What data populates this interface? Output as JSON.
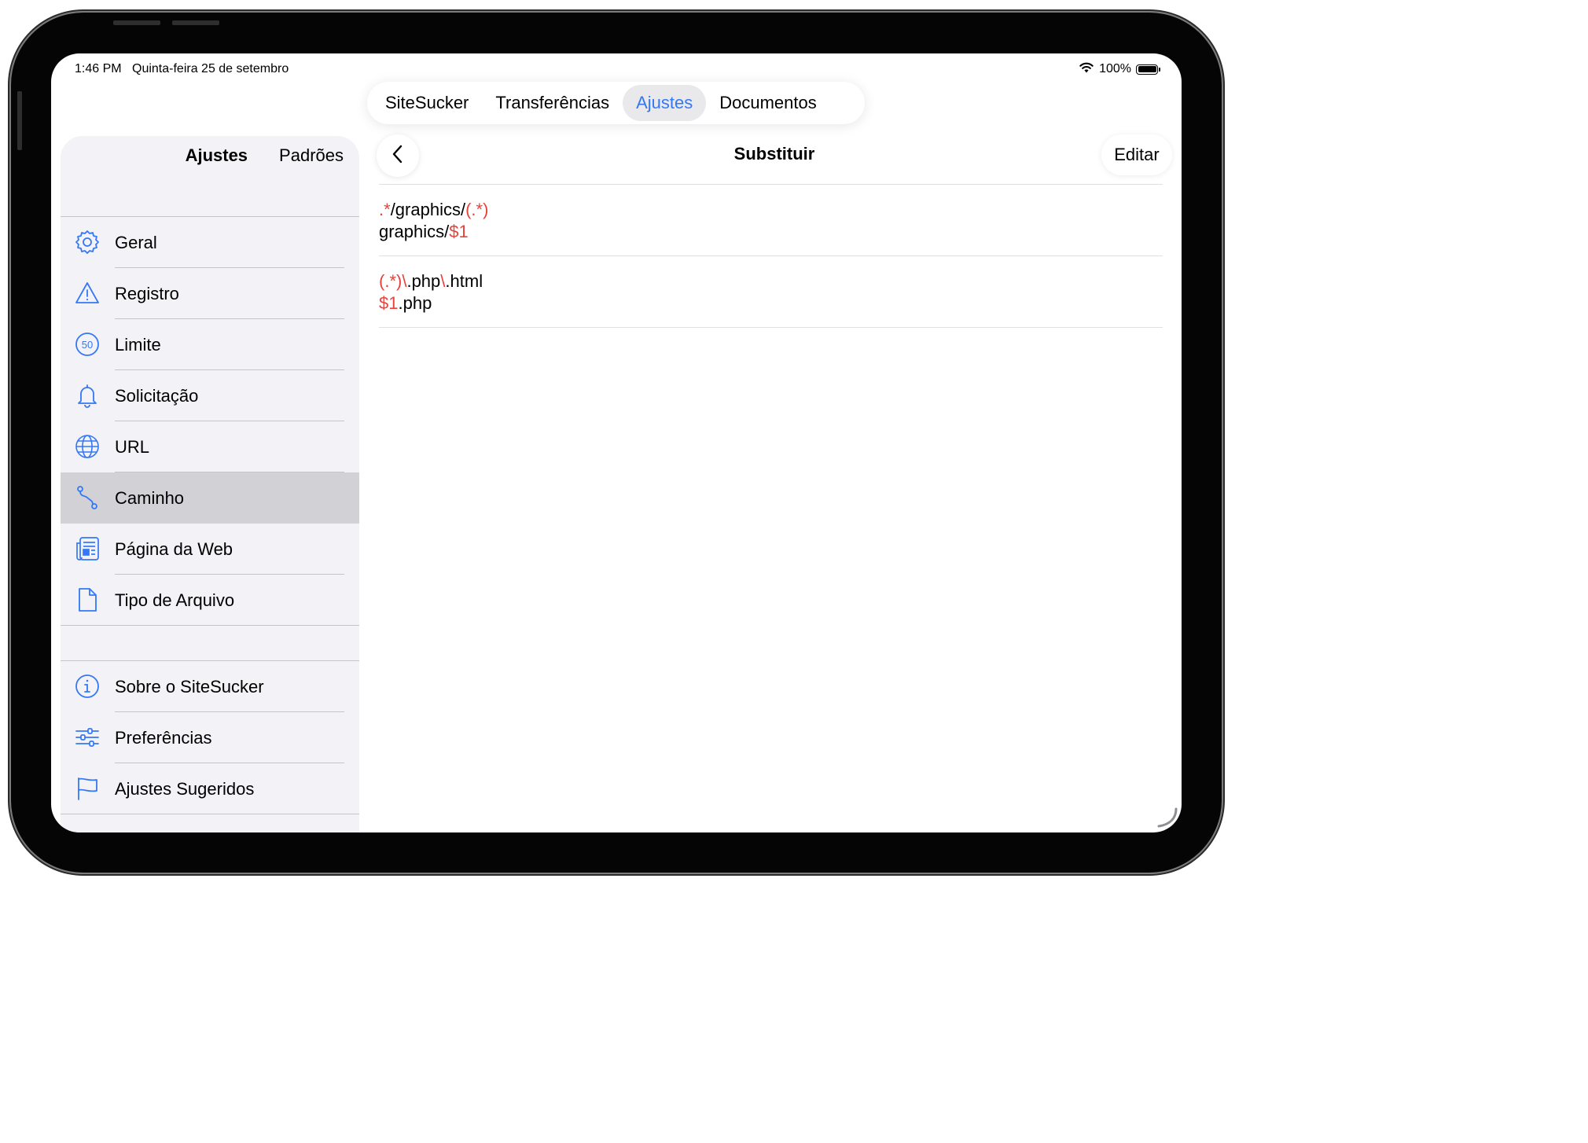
{
  "status_bar": {
    "time": "1:46 PM",
    "date": "Quinta-feira 25 de setembro",
    "battery": "100%"
  },
  "tabs": [
    {
      "label": "SiteSucker"
    },
    {
      "label": "Transferências"
    },
    {
      "label": "Ajustes",
      "active": true
    },
    {
      "label": "Documentos"
    }
  ],
  "sidebar": {
    "header": {
      "title": "Ajustes",
      "defaults": "Padrões"
    },
    "items": [
      {
        "label": "Geral",
        "icon": "gear-icon"
      },
      {
        "label": "Registro",
        "icon": "warning-icon"
      },
      {
        "label": "Limite",
        "icon": "limit-50-icon"
      },
      {
        "label": "Solicitação",
        "icon": "bell-icon"
      },
      {
        "label": "URL",
        "icon": "globe-icon"
      },
      {
        "label": "Caminho",
        "icon": "path-icon",
        "selected": true
      },
      {
        "label": "Página da Web",
        "icon": "webpage-icon"
      },
      {
        "label": "Tipo de Arquivo",
        "icon": "file-icon"
      }
    ],
    "extra_items": [
      {
        "label": "Sobre o SiteSucker",
        "icon": "info-icon"
      },
      {
        "label": "Preferências",
        "icon": "sliders-icon"
      },
      {
        "label": "Ajustes Sugeridos",
        "icon": "flag-icon"
      }
    ]
  },
  "detail": {
    "title": "Substituir",
    "edit_label": "Editar",
    "rules": [
      {
        "pattern": [
          {
            "t": ".*",
            "hl": true
          },
          {
            "t": "/graphics/"
          },
          {
            "t": "(.*)",
            "hl": true
          }
        ],
        "replacement": [
          {
            "t": "graphics/"
          },
          {
            "t": "$1",
            "hl": true
          }
        ]
      },
      {
        "pattern": [
          {
            "t": "(.*)\\",
            "hl": true
          },
          {
            "t": ".php"
          },
          {
            "t": "\\",
            "hl": true
          },
          {
            "t": ".html"
          }
        ],
        "replacement": [
          {
            "t": "$1",
            "hl": true
          },
          {
            "t": ".php"
          }
        ]
      }
    ]
  },
  "colors": {
    "accent": "#3478f6",
    "highlight": "#e8433a",
    "sidebar_bg": "#f2f2f7",
    "selected_row": "#d1d1d6"
  }
}
